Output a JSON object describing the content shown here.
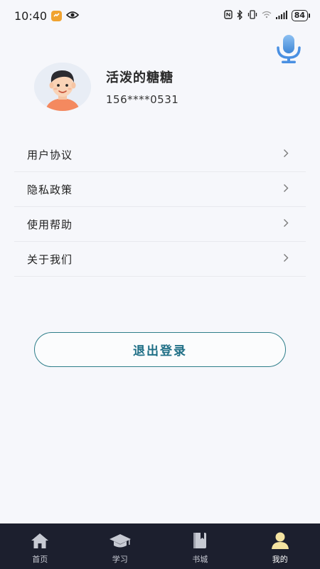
{
  "status_bar": {
    "time": "10:40",
    "battery": "84",
    "wifi_icon": "wifi-icon",
    "signal_icon": "signal-icon"
  },
  "header": {
    "mic_icon": "microphone-icon",
    "mic_color": "#4a90e2"
  },
  "profile": {
    "nickname": "活泼的糖糖",
    "phone": "156****0531",
    "avatar_icon": "avatar"
  },
  "menu": {
    "items": [
      {
        "label": "用户协议"
      },
      {
        "label": "隐私政策"
      },
      {
        "label": "使用帮助"
      },
      {
        "label": "关于我们"
      }
    ],
    "chevron": "›"
  },
  "logout": {
    "label": "退出登录",
    "accent": "#1f6f86"
  },
  "bottom_nav": {
    "background": "#1c1f2e",
    "items": [
      {
        "label": "首页",
        "icon": "home-icon",
        "active": false
      },
      {
        "label": "学习",
        "icon": "graduation-cap-icon",
        "active": false
      },
      {
        "label": "书城",
        "icon": "book-icon",
        "active": false
      },
      {
        "label": "我的",
        "icon": "user-icon",
        "active": true
      }
    ],
    "active_color": "#f4e3a1"
  }
}
